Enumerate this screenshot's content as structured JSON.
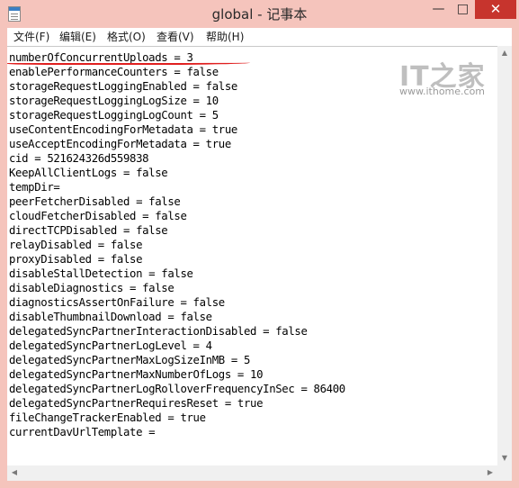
{
  "window": {
    "title": "global - 记事本"
  },
  "caption_buttons": {
    "minimize": "—",
    "maximize": "□",
    "close": "✕"
  },
  "menu": {
    "items": [
      {
        "label": "文件(F)"
      },
      {
        "label": "编辑(E)"
      },
      {
        "label": "格式(O)"
      },
      {
        "label": "查看(V)"
      },
      {
        "label": "帮助(H)"
      }
    ]
  },
  "editor": {
    "content": "numberOfConcurrentUploads = 3\nenablePerformanceCounters = false\nstorageRequestLoggingEnabled = false\nstorageRequestLoggingLogSize = 10\nstorageRequestLoggingLogCount = 5\nuseContentEncodingForMetadata = true\nuseAcceptEncodingForMetadata = true\ncid = 521624326d559838\nKeepAllClientLogs = false\ntempDir=\npeerFetcherDisabled = false\ncloudFetcherDisabled = false\ndirectTCPDisabled = false\nrelayDisabled = false\nproxyDisabled = false\ndisableStallDetection = false\ndisableDiagnostics = false\ndiagnosticsAssertOnFailure = false\ndisableThumbnailDownload = false\ndelegatedSyncPartnerInteractionDisabled = false\ndelegatedSyncPartnerLogLevel = 4\ndelegatedSyncPartnerMaxLogSizeInMB = 5\ndelegatedSyncPartnerMaxNumberOfLogs = 10\ndelegatedSyncPartnerLogRolloverFrequencyInSec = 86400\ndelegatedSyncPartnerRequiresReset = true\nfileChangeTrackerEnabled = true\ncurrentDavUrlTemplate ="
  },
  "watermark": {
    "logo": "IT之家",
    "url": "www.ithome.com"
  },
  "colors": {
    "title_bar": "#f5c4bc",
    "close_button": "#c7342d",
    "annotation_underline": "#e02020"
  }
}
